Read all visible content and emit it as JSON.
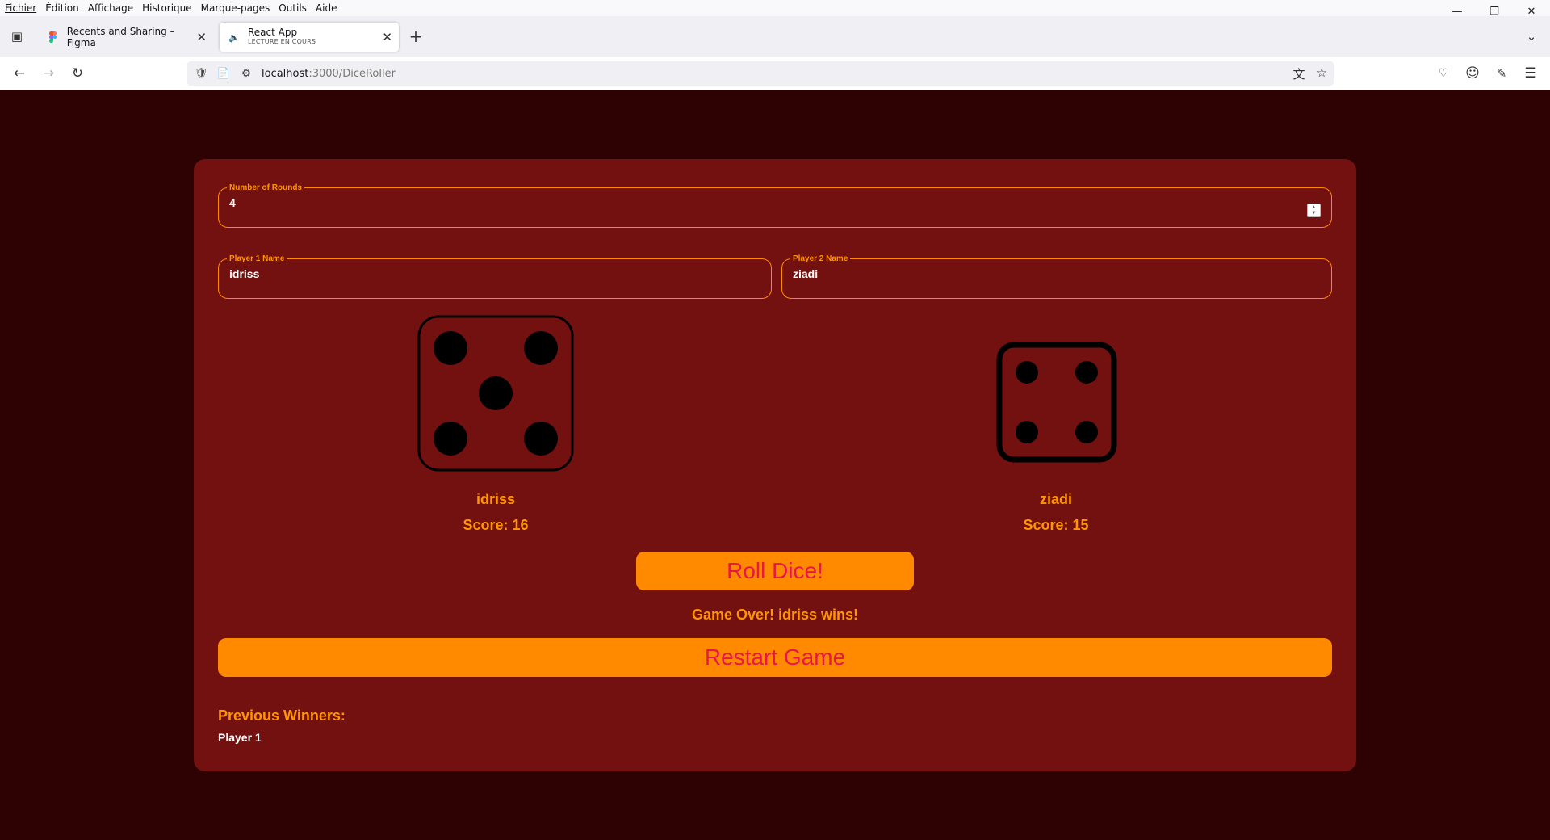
{
  "browser": {
    "menu": [
      "Fichier",
      "Édition",
      "Affichage",
      "Historique",
      "Marque-pages",
      "Outils",
      "Aide"
    ],
    "tabs": [
      {
        "title": "Recents and Sharing – Figma",
        "icon": "figma-icon"
      },
      {
        "title": "React App",
        "subtitle": "LECTURE EN COURS",
        "icon": "speaker-icon"
      }
    ],
    "url": {
      "host": "localhost",
      "path": ":3000/DiceRoller"
    }
  },
  "game": {
    "rounds": {
      "label": "Number of Rounds",
      "value": "4"
    },
    "player1": {
      "label": "Player 1 Name",
      "value": "idriss",
      "name": "idriss",
      "score": "Score: 16",
      "dice_value": 5
    },
    "player2": {
      "label": "Player 2 Name",
      "value": "ziadi",
      "name": "ziadi",
      "score": "Score: 15",
      "dice_value": 4
    },
    "roll_button": "Roll Dice!",
    "status": "Game Over! idriss wins!",
    "restart_button": "Restart Game",
    "winners_title": "Previous Winners:",
    "winners": [
      "Player 1"
    ]
  },
  "colors": {
    "page_bg": "#2e0202",
    "card_bg": "#731010",
    "accent": "#ff8a00",
    "button_text": "#e8174a"
  }
}
